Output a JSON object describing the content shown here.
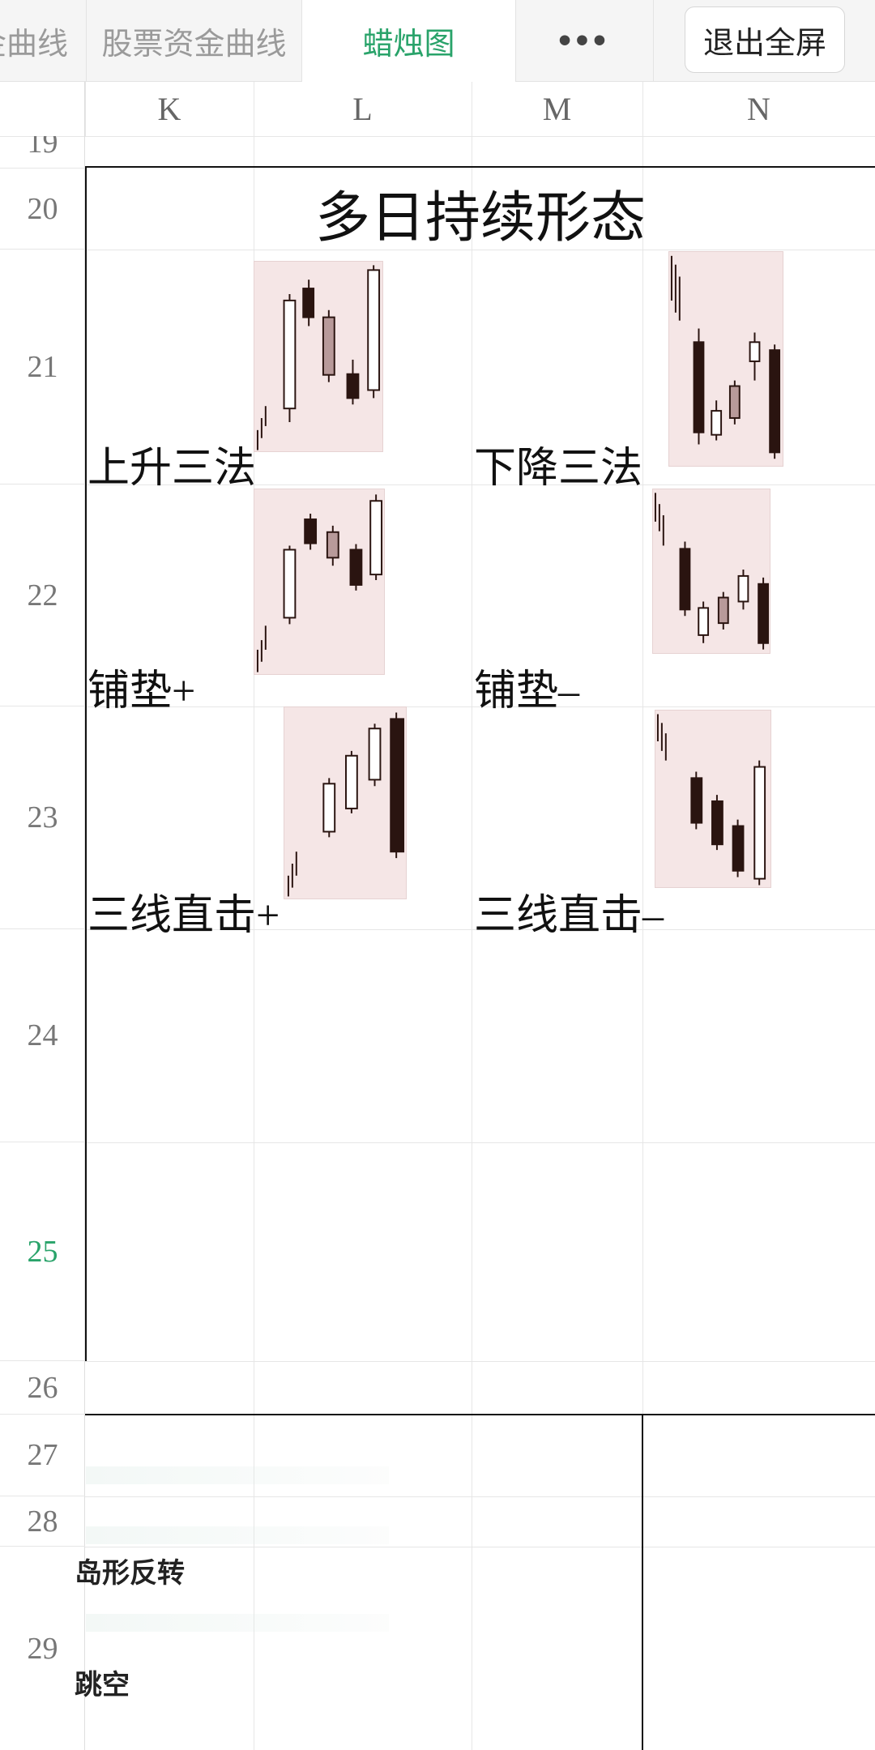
{
  "tabs": [
    {
      "label": "金曲线"
    },
    {
      "label": "股票资金曲线"
    },
    {
      "label": "蜡烛图"
    }
  ],
  "active_tab_index": 2,
  "more_label": "•••",
  "exit_label": "退出全屏",
  "columns": [
    "K",
    "L",
    "M",
    "N"
  ],
  "rows": [
    "19",
    "20",
    "21",
    "22",
    "23",
    "24",
    "25",
    "26",
    "27",
    "28",
    "29"
  ],
  "selected_row": "25",
  "block_title": "多日持续形态",
  "patterns": [
    {
      "label": "上升三法"
    },
    {
      "label": "下降三法"
    },
    {
      "label": "铺垫+"
    },
    {
      "label": "铺垫–"
    },
    {
      "label": "三线直击+"
    },
    {
      "label": "三线直击–"
    }
  ],
  "partial_labels": [
    "岛形反转",
    "跳空"
  ],
  "colors": {
    "active_tab": "#29a36a",
    "candle_bg": "#f5e6e6",
    "candle_dark": "#2a1410"
  }
}
